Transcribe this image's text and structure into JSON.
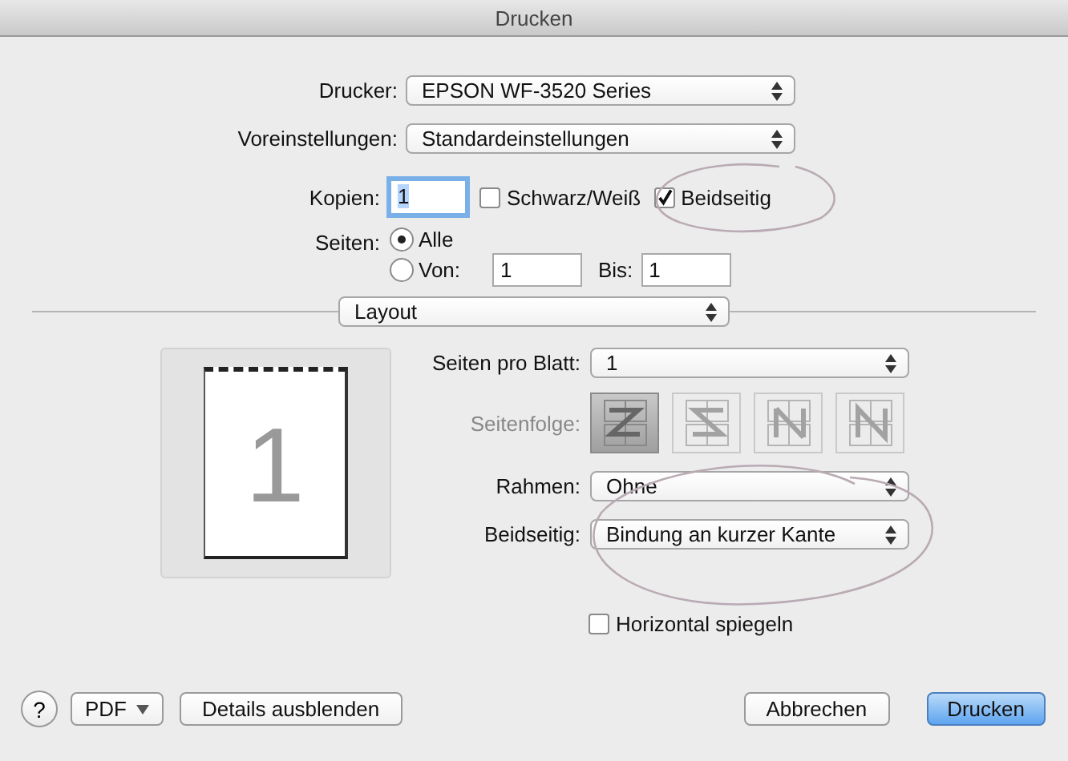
{
  "window": {
    "title": "Drucken"
  },
  "printer": {
    "label": "Drucker:",
    "value": "EPSON WF-3520 Series"
  },
  "presets": {
    "label": "Voreinstellungen:",
    "value": "Standardeinstellungen"
  },
  "copies": {
    "label": "Kopien:",
    "value": "1",
    "focused": true
  },
  "options": [
    {
      "label": "Schwarz/Weiß",
      "checked": false
    },
    {
      "label": "Beidseitig",
      "checked": true
    }
  ],
  "pages": {
    "label": "Seiten:",
    "choices": [
      {
        "label": "Alle",
        "selected": true
      },
      {
        "label": "Von:",
        "selected": false
      }
    ],
    "from": "1",
    "to_label": "Bis:",
    "to": "1"
  },
  "panel_menu": {
    "value": "Layout"
  },
  "preview": {
    "page_number": "1"
  },
  "layout": {
    "pages_per_sheet": {
      "label": "Seiten pro Blatt:",
      "value": "1"
    },
    "order": {
      "label": "Seitenfolge:",
      "disabled": true,
      "choices": [
        {
          "kind": "z",
          "selected": true
        },
        {
          "kind": "s",
          "selected": false
        },
        {
          "kind": "n_rev",
          "selected": false
        },
        {
          "kind": "n",
          "selected": false
        }
      ]
    },
    "border": {
      "label": "Rahmen:",
      "value": "Ohne"
    },
    "two_sided": {
      "label": "Beidseitig:",
      "value": "Bindung an kurzer Kante"
    },
    "flip": {
      "label": "Horizontal spiegeln",
      "checked": false
    }
  },
  "footer": {
    "help": "?",
    "pdf": "PDF",
    "details": "Details ausblenden",
    "cancel": "Abbrechen",
    "print": "Drucken"
  }
}
